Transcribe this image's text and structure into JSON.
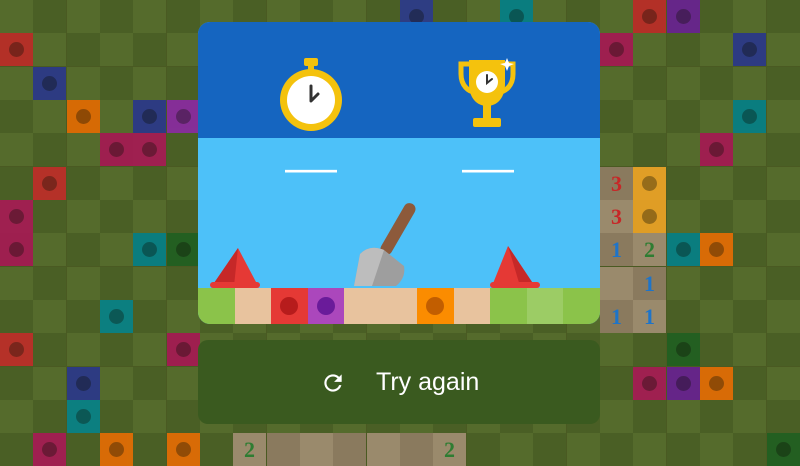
{
  "colors": {
    "board_light": "#556b2c",
    "board_dark": "#4a5f25",
    "modal_top": "#1565c0",
    "modal_sky": "#4dc1f9",
    "button_bg": "#3a5a1f",
    "num1": "#1e74c9",
    "num2": "#2e7d32",
    "num3": "#c62828",
    "timer_gold": "#f4c20d",
    "flag_red": "#e53935"
  },
  "board": {
    "mines": [
      {
        "c": 0,
        "r": 1,
        "color": "#c62828"
      },
      {
        "c": 12,
        "r": 0,
        "color": "#283593"
      },
      {
        "c": 15,
        "r": 0,
        "color": "#00838f"
      },
      {
        "c": 19,
        "r": 0,
        "color": "#c62828"
      },
      {
        "c": 20,
        "r": 0,
        "color": "#6a1b9a"
      },
      {
        "c": 1,
        "r": 2,
        "color": "#283593"
      },
      {
        "c": 18,
        "r": 1,
        "color": "#ad1457"
      },
      {
        "c": 22,
        "r": 1,
        "color": "#283593"
      },
      {
        "c": 2,
        "r": 3,
        "color": "#ef6c00"
      },
      {
        "c": 4,
        "r": 3,
        "color": "#283593"
      },
      {
        "c": 5,
        "r": 3,
        "color": "#8e24aa"
      },
      {
        "c": 3,
        "r": 4,
        "color": "#ad1457"
      },
      {
        "c": 4,
        "r": 4,
        "color": "#ad1457"
      },
      {
        "c": 22,
        "r": 3,
        "color": "#00838f"
      },
      {
        "c": 21,
        "r": 4,
        "color": "#ad1457"
      },
      {
        "c": 1,
        "r": 5,
        "color": "#c62828"
      },
      {
        "c": 19,
        "r": 5,
        "color": "#f9a825"
      },
      {
        "c": 19,
        "r": 6,
        "color": "#f9a825"
      },
      {
        "c": 0,
        "r": 6,
        "color": "#ad1457"
      },
      {
        "c": 0,
        "r": 7,
        "color": "#ad1457"
      },
      {
        "c": 4,
        "r": 7,
        "color": "#00838f"
      },
      {
        "c": 5,
        "r": 7,
        "color": "#1b5e20"
      },
      {
        "c": 20,
        "r": 7,
        "color": "#00838f"
      },
      {
        "c": 21,
        "r": 7,
        "color": "#ef6c00"
      },
      {
        "c": 3,
        "r": 9,
        "color": "#00838f"
      },
      {
        "c": 0,
        "r": 10,
        "color": "#c62828"
      },
      {
        "c": 5,
        "r": 10,
        "color": "#ad1457"
      },
      {
        "c": 20,
        "r": 10,
        "color": "#1b5e20"
      },
      {
        "c": 2,
        "r": 11,
        "color": "#283593"
      },
      {
        "c": 2,
        "r": 12,
        "color": "#00838f"
      },
      {
        "c": 19,
        "r": 11,
        "color": "#ad1457"
      },
      {
        "c": 20,
        "r": 11,
        "color": "#6a1b9a"
      },
      {
        "c": 21,
        "r": 11,
        "color": "#ef6c00"
      },
      {
        "c": 1,
        "r": 13,
        "color": "#ad1457"
      },
      {
        "c": 3,
        "r": 13,
        "color": "#ef6c00"
      },
      {
        "c": 5,
        "r": 13,
        "color": "#ef6c00"
      },
      {
        "c": 23,
        "r": 13,
        "color": "#1b5e20"
      }
    ],
    "revealed": [
      {
        "c": 18,
        "r": 5
      },
      {
        "c": 18,
        "r": 6
      },
      {
        "c": 18,
        "r": 7
      },
      {
        "c": 18,
        "r": 8
      },
      {
        "c": 18,
        "r": 9
      },
      {
        "c": 19,
        "r": 7
      },
      {
        "c": 19,
        "r": 8
      },
      {
        "c": 19,
        "r": 9
      },
      {
        "c": 7,
        "r": 13
      },
      {
        "c": 8,
        "r": 13
      },
      {
        "c": 9,
        "r": 13
      },
      {
        "c": 10,
        "r": 13
      },
      {
        "c": 11,
        "r": 13
      },
      {
        "c": 12,
        "r": 13
      },
      {
        "c": 13,
        "r": 13
      }
    ],
    "numbers": [
      {
        "c": 18,
        "r": 5,
        "n": "3",
        "color": "#c62828"
      },
      {
        "c": 18,
        "r": 6,
        "n": "3",
        "color": "#c62828"
      },
      {
        "c": 18,
        "r": 7,
        "n": "1",
        "color": "#1e74c9"
      },
      {
        "c": 19,
        "r": 7,
        "n": "2",
        "color": "#2e7d32"
      },
      {
        "c": 19,
        "r": 8,
        "n": "1",
        "color": "#1e74c9"
      },
      {
        "c": 18,
        "r": 9,
        "n": "1",
        "color": "#1e74c9"
      },
      {
        "c": 19,
        "r": 9,
        "n": "1",
        "color": "#1e74c9"
      },
      {
        "c": 7,
        "r": 13,
        "n": "2",
        "color": "#2e7d32"
      },
      {
        "c": 13,
        "r": 13,
        "n": "2",
        "color": "#2e7d32"
      }
    ]
  },
  "modal": {
    "time_icon": "stopwatch-icon",
    "best_icon": "trophy-icon",
    "time_value": "——",
    "best_value": "——",
    "strip": [
      {
        "color": "#8bc34a"
      },
      {
        "color": "#e8c39e"
      },
      {
        "color": "#e53935",
        "dot": "#b71c1c"
      },
      {
        "color": "#ab47bc",
        "dot": "#6a1b9a"
      },
      {
        "color": "#e8c39e"
      },
      {
        "color": "#e8c39e"
      },
      {
        "color": "#fb8c00",
        "dot": "#c25e00"
      },
      {
        "color": "#e8c39e"
      },
      {
        "color": "#8bc34a"
      },
      {
        "color": "#9ccc65"
      },
      {
        "color": "#8bc34a"
      }
    ]
  },
  "button": {
    "label": "Try again",
    "icon": "refresh-icon"
  }
}
